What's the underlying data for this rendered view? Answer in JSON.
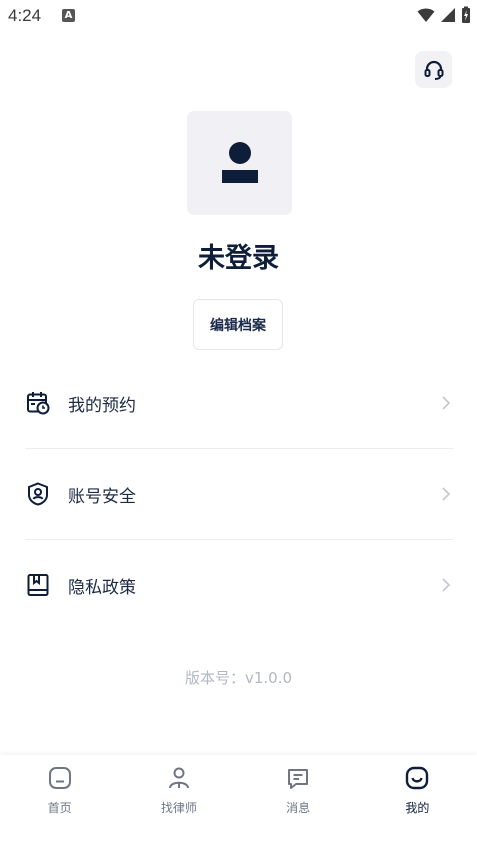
{
  "status_bar": {
    "time": "4:24",
    "notification_letter": "A"
  },
  "profile": {
    "username": "未登录",
    "edit_label": "编辑档案"
  },
  "menu": {
    "items": [
      {
        "label": "我的预约",
        "icon": "calendar-clock-icon"
      },
      {
        "label": "账号安全",
        "icon": "shield-user-icon"
      },
      {
        "label": "隐私政策",
        "icon": "book-icon"
      }
    ]
  },
  "version": "版本号：v1.0.0",
  "tabs": [
    {
      "label": "首页",
      "icon": "home-icon",
      "active": false
    },
    {
      "label": "找律师",
      "icon": "person-icon",
      "active": false
    },
    {
      "label": "消息",
      "icon": "message-icon",
      "active": false
    },
    {
      "label": "我的",
      "icon": "smile-icon",
      "active": true
    }
  ],
  "colors": {
    "primary": "#0e1e3a",
    "inactive": "#6e7685",
    "muted": "#b2b7c2",
    "avatar_bg": "#f1f1f5"
  }
}
